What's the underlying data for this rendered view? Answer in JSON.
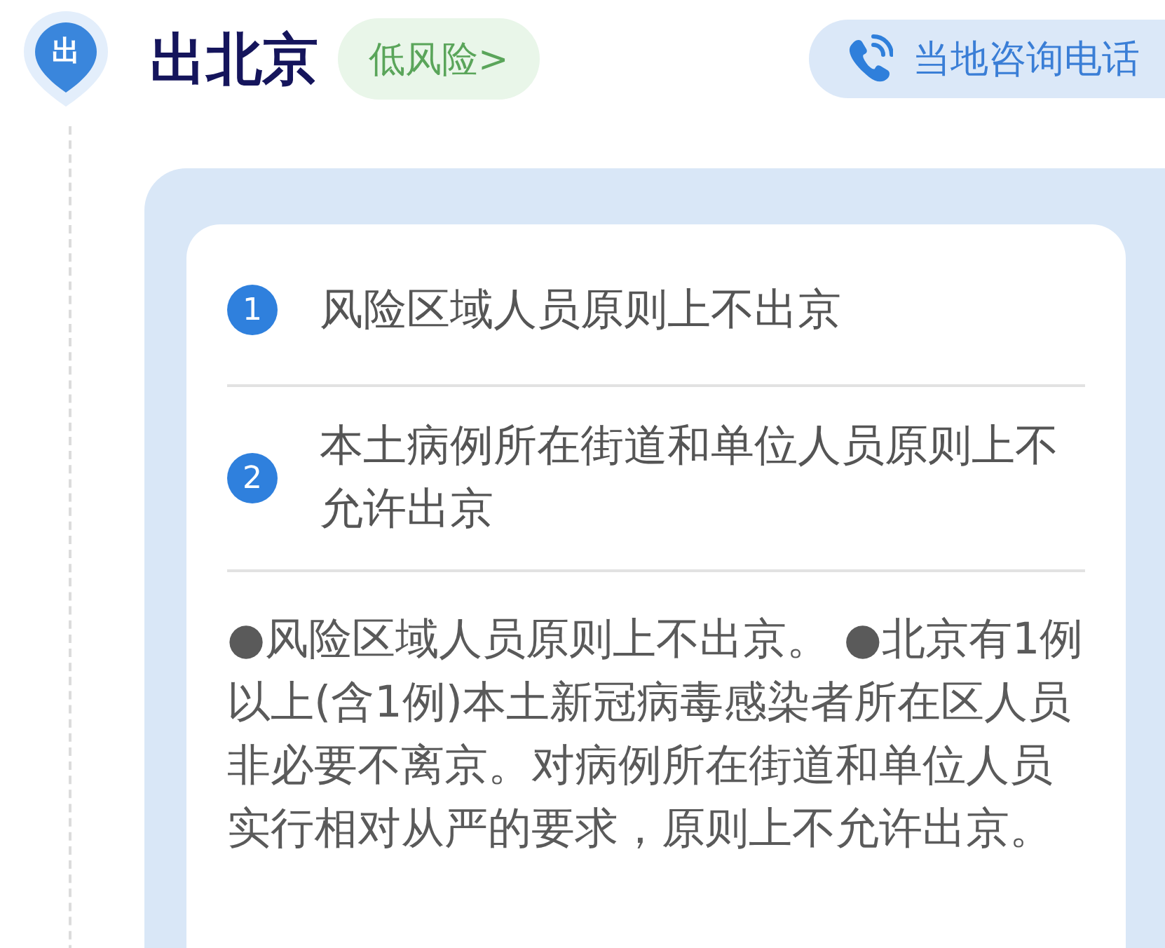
{
  "header": {
    "pin_label": "出",
    "title": "出北京",
    "risk_badge": {
      "label": "低风险>",
      "kind": "low"
    },
    "phone_button": {
      "label": "当地咨询电话"
    }
  },
  "rules": [
    {
      "number": "1",
      "text": "风险区域人员原则上不出京"
    },
    {
      "number": "2",
      "text": "本土病例所在街道和单位人员原则上不允许出京"
    }
  ],
  "details": "●风险区域人员原则上不出京。 ●北京有1例以上(含1例)本土新冠病毒感染者所在区人员非必要不离京。对病例所在街道和单位人员实行相对从严的要求，原则上不允许出京。"
}
